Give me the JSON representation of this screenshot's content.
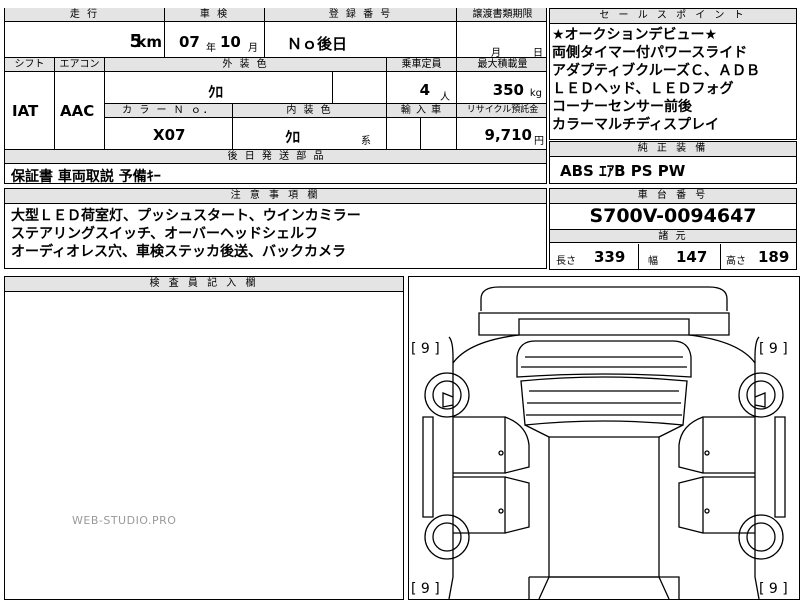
{
  "top_row": {
    "labels": {
      "mileage": "走 行",
      "inspection": "車 検",
      "registration": "登 録 番 号",
      "transfer_date": "譲渡書類期限"
    },
    "mileage_value": "5",
    "mileage_unit": "km",
    "inspection_year": "07",
    "inspection_year_unit": "年",
    "inspection_month": "10",
    "inspection_month_unit": "月",
    "registration_value": "Ｎｏ後日",
    "transfer_month_unit": "月",
    "transfer_day_unit": "日"
  },
  "second_row": {
    "labels": {
      "shift": "シフト",
      "aircon": "エアコン",
      "exterior_color": "外 装 色",
      "capacity": "乗車定員",
      "max_load": "最大積載量",
      "color_no": "カ ラ ー Ｎ ｏ．",
      "interior_color": "内 装 色",
      "import": "輸 入 車",
      "recycle": "リサイクル預託金"
    },
    "shift": "IAT",
    "aircon": "AAC",
    "exterior_color": "ｸﾛ",
    "capacity": "4",
    "capacity_unit": "人",
    "max_load": "350",
    "max_load_unit": "kg",
    "color_no": "X07",
    "interior_color": "ｸﾛ",
    "interior_suffix": "系",
    "recycle": "9,710",
    "recycle_unit": "円"
  },
  "later_parts": {
    "label": "後 日 発 送 部 品",
    "value": "保証書 車両取説 予備ｷｰ"
  },
  "notes": {
    "label": "注 意 事 項 欄",
    "lines": [
      "大型ＬＥＤ荷室灯、プッシュスタート、ウインカミラー",
      "ステアリングスイッチ、オーバーヘッドシェルフ",
      "オーディオレス穴、車検ステッカ後送、バックカメラ"
    ]
  },
  "sales_points": {
    "label": "セ ー ル ス ポ イ ン ト",
    "lines": [
      "★オークションデビュー★",
      "両側タイマー付パワースライド",
      "アダプティブクルーズＣ、ＡＤＢ",
      "ＬＥＤヘッド、ＬＥＤフォグ",
      "コーナーセンサー前後",
      "カラーマルチディスプレイ"
    ]
  },
  "genuine_equipment": {
    "label": "純 正 装 備",
    "value": "ABS ｴｱB PS PW"
  },
  "chassis": {
    "label": "車 台 番 号",
    "value": "S700V-0094647"
  },
  "specs": {
    "label": "諸 元",
    "length_label": "長さ",
    "length": "339",
    "width_label": "幅",
    "width": "147",
    "height_label": "高さ",
    "height": "189"
  },
  "inspector": {
    "label": "検 査 員 記 入 欄"
  },
  "diagram": {
    "tire_labels": [
      "[ 9 ]",
      "[ 9 ]",
      "[ 9 ]",
      "[ 9 ]"
    ]
  },
  "watermark": "WEB-STUDIO.PRO"
}
